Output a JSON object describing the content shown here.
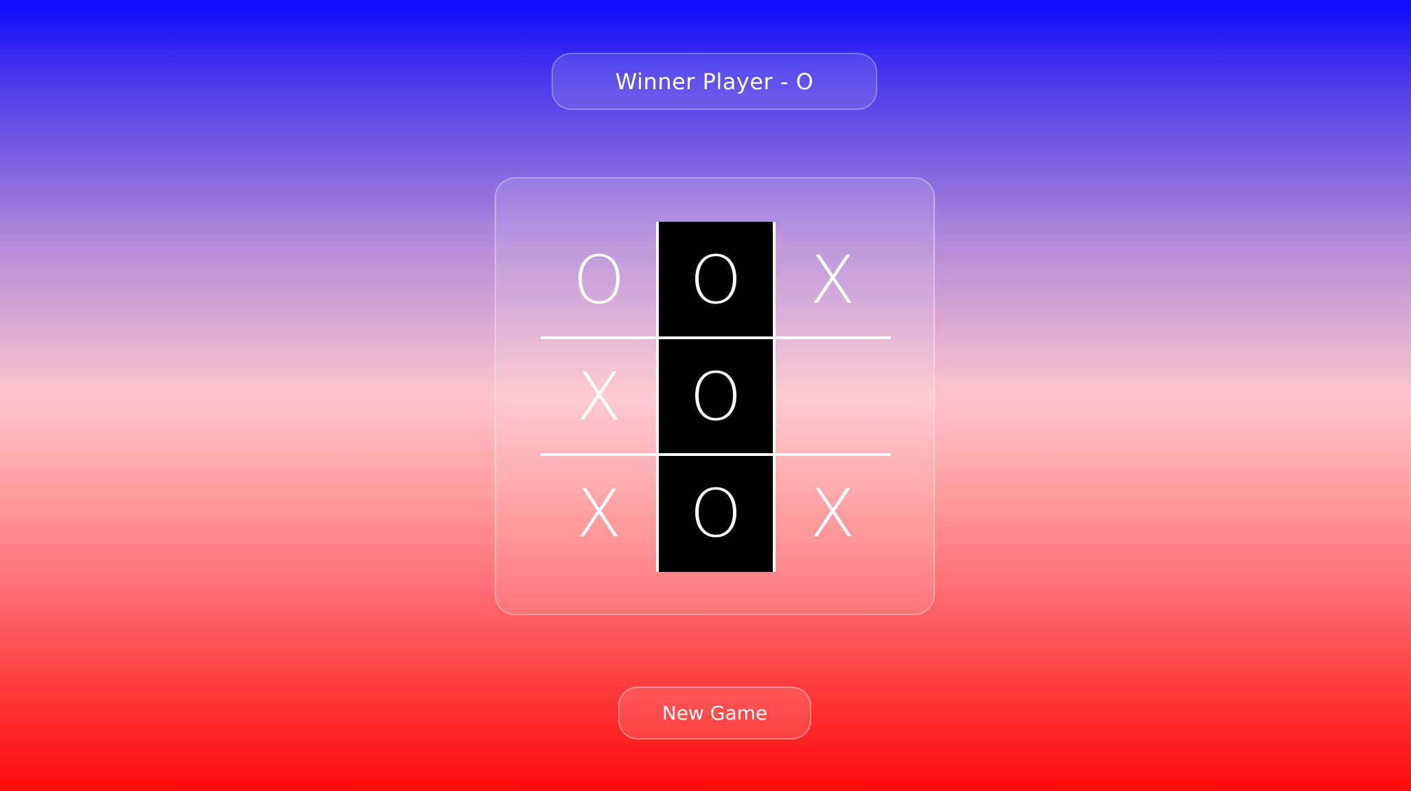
{
  "status": {
    "text": "Winner Player - O"
  },
  "board": {
    "cells": [
      "O",
      "O",
      "X",
      "X",
      "O",
      "",
      "X",
      "O",
      "X"
    ],
    "winning_cells": [
      1,
      4,
      7
    ],
    "winner": "O"
  },
  "controls": {
    "new_game_label": "New Game"
  },
  "colors": {
    "gradient_top": "#0a0aff",
    "gradient_middle": "#ffc4cc",
    "gradient_bottom": "#ff0a0a",
    "win_highlight": "#000000",
    "mark_color": "#ffffff"
  }
}
